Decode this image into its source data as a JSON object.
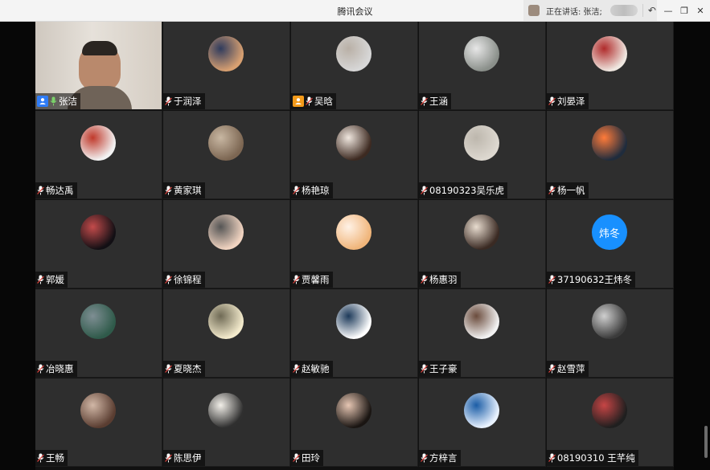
{
  "window": {
    "title": "腾讯会议"
  },
  "speaking": {
    "label": "正在讲话: 张洁;"
  },
  "controls": {
    "minimize": "—",
    "restore": "❐",
    "close": "✕",
    "back": "↶"
  },
  "participants": [
    {
      "name": "张洁",
      "type": "video",
      "badge": "host"
    },
    {
      "name": "于润泽",
      "type": "avatar",
      "colors": [
        "#d8a071",
        "#2f3b5d"
      ]
    },
    {
      "name": "吴晗",
      "type": "avatar",
      "colors": [
        "#d7d7d7",
        "#b9b0a6"
      ],
      "badge": "cohost"
    },
    {
      "name": "王涵",
      "type": "avatar",
      "colors": [
        "#8a8f8a",
        "#e7e7e7"
      ]
    },
    {
      "name": "刘晏泽",
      "type": "avatar",
      "colors": [
        "#efe7e0",
        "#b02b2b"
      ]
    },
    {
      "name": "畅达禹",
      "type": "avatar",
      "colors": [
        "#f2f2f2",
        "#c0392b"
      ]
    },
    {
      "name": "黄家琪",
      "type": "avatar",
      "colors": [
        "#7c6652",
        "#c8b7a2"
      ]
    },
    {
      "name": "杨艳琼",
      "type": "avatar",
      "colors": [
        "#3d2a21",
        "#f0e7df"
      ]
    },
    {
      "name": "08190323吴乐虎",
      "type": "avatar",
      "colors": [
        "#ddd8d0",
        "#bdb7ad"
      ]
    },
    {
      "name": "杨一帆",
      "type": "avatar",
      "colors": [
        "#1f2c3d",
        "#ff7b3a"
      ]
    },
    {
      "name": "郭媛",
      "type": "avatar",
      "colors": [
        "#120f14",
        "#c34b4b"
      ]
    },
    {
      "name": "徐锦程",
      "type": "avatar",
      "colors": [
        "#f1d4c1",
        "#555"
      ]
    },
    {
      "name": "贾馨雨",
      "type": "avatar",
      "colors": [
        "#f0b57a",
        "#fff2e6"
      ]
    },
    {
      "name": "杨惠羽",
      "type": "avatar",
      "colors": [
        "#3a2a23",
        "#e8dccf"
      ]
    },
    {
      "name": "37190632王炜冬",
      "type": "text",
      "text": "炜冬"
    },
    {
      "name": "冶晓惠",
      "type": "avatar",
      "colors": [
        "#2f5a4a",
        "#7e8e93"
      ]
    },
    {
      "name": "夏晓杰",
      "type": "avatar",
      "colors": [
        "#f3eacc",
        "#6f6a55"
      ]
    },
    {
      "name": "赵敏驰",
      "type": "avatar",
      "colors": [
        "#ffffff",
        "#1d3a5a"
      ]
    },
    {
      "name": "王子豪",
      "type": "avatar",
      "colors": [
        "#f2f2f2",
        "#6b4c3d"
      ]
    },
    {
      "name": "赵雪萍",
      "type": "avatar",
      "colors": [
        "#3b3b3b",
        "#cfcfcf"
      ]
    },
    {
      "name": "王畅",
      "type": "avatar",
      "colors": [
        "#5a3d31",
        "#d1b7a6"
      ]
    },
    {
      "name": "陈思伊",
      "type": "avatar",
      "colors": [
        "#2f2f2f",
        "#f2efe9"
      ]
    },
    {
      "name": "田玲",
      "type": "avatar",
      "colors": [
        "#1a1512",
        "#e6c6b3"
      ]
    },
    {
      "name": "方梓言",
      "type": "avatar",
      "colors": [
        "#e9f2ff",
        "#1b5da6"
      ]
    },
    {
      "name": "08190310 王芊纯",
      "type": "avatar",
      "colors": [
        "#1f1f1f",
        "#c74545"
      ]
    }
  ]
}
